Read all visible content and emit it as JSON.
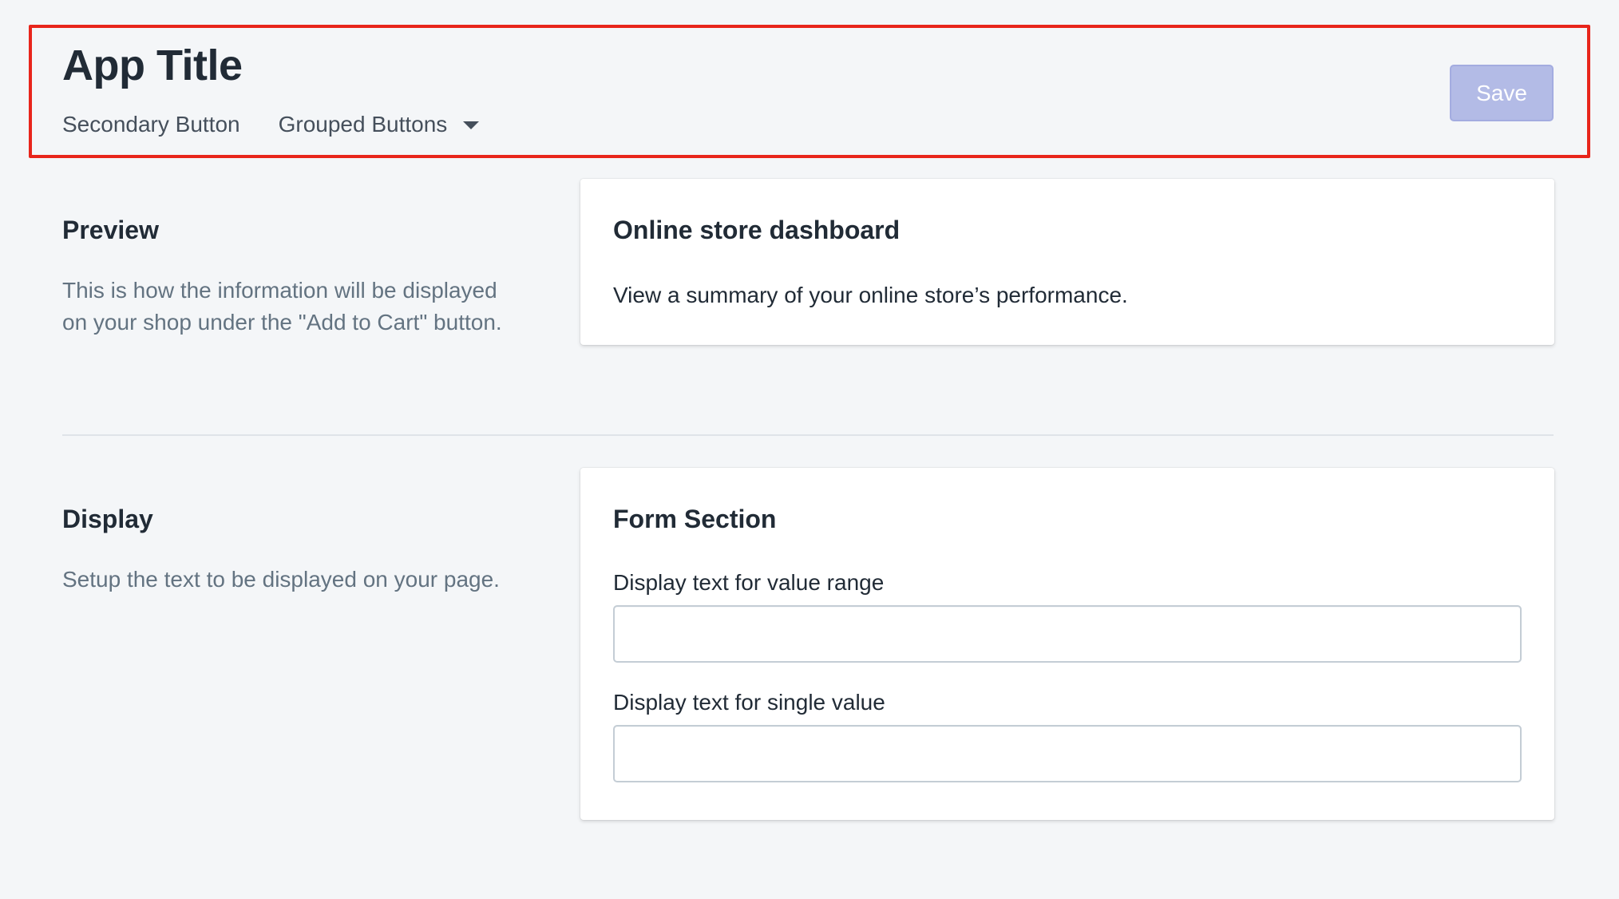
{
  "header": {
    "title": "App Title",
    "secondary_actions": [
      {
        "label": "Secondary Button",
        "has_menu": false
      },
      {
        "label": "Grouped Buttons",
        "has_menu": true
      }
    ],
    "primary_action": {
      "label": "Save",
      "disabled": true
    }
  },
  "sections": [
    {
      "heading": "Preview",
      "description": "This is how the information will be displayed on your shop under the \"Add to Cart\" button.",
      "card": {
        "title": "Online store dashboard",
        "text": "View a summary of your online store’s performance."
      }
    },
    {
      "heading": "Display",
      "description": "Setup the text to be displayed on your page.",
      "card": {
        "title": "Form Section",
        "fields": [
          {
            "label": "Display text for value range",
            "value": "",
            "placeholder": ""
          },
          {
            "label": "Display text for single value",
            "value": "",
            "placeholder": ""
          }
        ]
      }
    }
  ],
  "colors": {
    "background": "#f4f6f8",
    "primary_disabled": "#b3bbe6",
    "highlight": "#e8251b",
    "text": "#212b36",
    "subdued_text": "#637381"
  },
  "icons": {
    "grouped_buttons_disclosure": "chevron-down-icon"
  }
}
